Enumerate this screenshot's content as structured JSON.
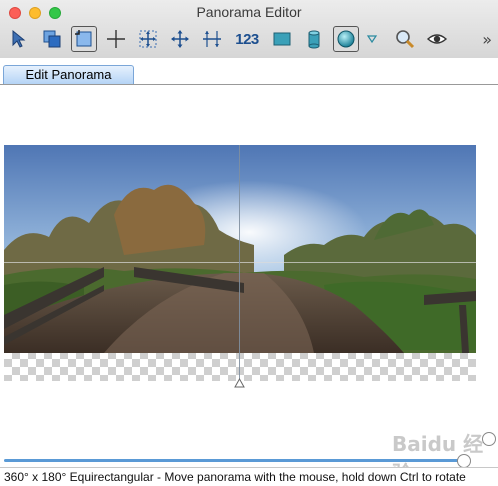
{
  "window": {
    "title": "Panorama Editor"
  },
  "toolbar": {
    "tools": [
      {
        "icon": "select-arrow-icon",
        "selected": false
      },
      {
        "icon": "overlay-images-icon",
        "selected": false
      },
      {
        "icon": "crop-frame-icon",
        "selected": true
      },
      {
        "icon": "crosshair-icon",
        "selected": false
      },
      {
        "icon": "expand-arrows-icon",
        "selected": false
      },
      {
        "icon": "move-cross-icon",
        "selected": false
      },
      {
        "icon": "straighten-icon",
        "selected": false
      },
      {
        "icon": "numbers-123-icon",
        "selected": false,
        "label": "123"
      },
      {
        "icon": "rectilinear-projection-icon",
        "selected": false
      },
      {
        "icon": "cylinder-projection-icon",
        "selected": false
      },
      {
        "icon": "sphere-projection-icon",
        "selected": true
      },
      {
        "icon": "dropdown-triangle-icon",
        "selected": false
      },
      {
        "icon": "magnifier-icon",
        "selected": false
      },
      {
        "icon": "eye-preview-icon",
        "selected": false
      }
    ],
    "overflow_label": "»"
  },
  "tabs": [
    {
      "label": "Edit Panorama",
      "active": true
    }
  ],
  "status": {
    "text": "360° x 180° Equirectangular - Move panorama with the mouse, hold down Ctrl to rotate"
  },
  "watermark": {
    "text": "Baidu 经验"
  },
  "colors": {
    "accent": "#5a9ad6",
    "tab_fill": "#b5d4f6",
    "close": "#fc5f57",
    "minimize": "#fdbc2e",
    "maximize": "#33c748"
  }
}
